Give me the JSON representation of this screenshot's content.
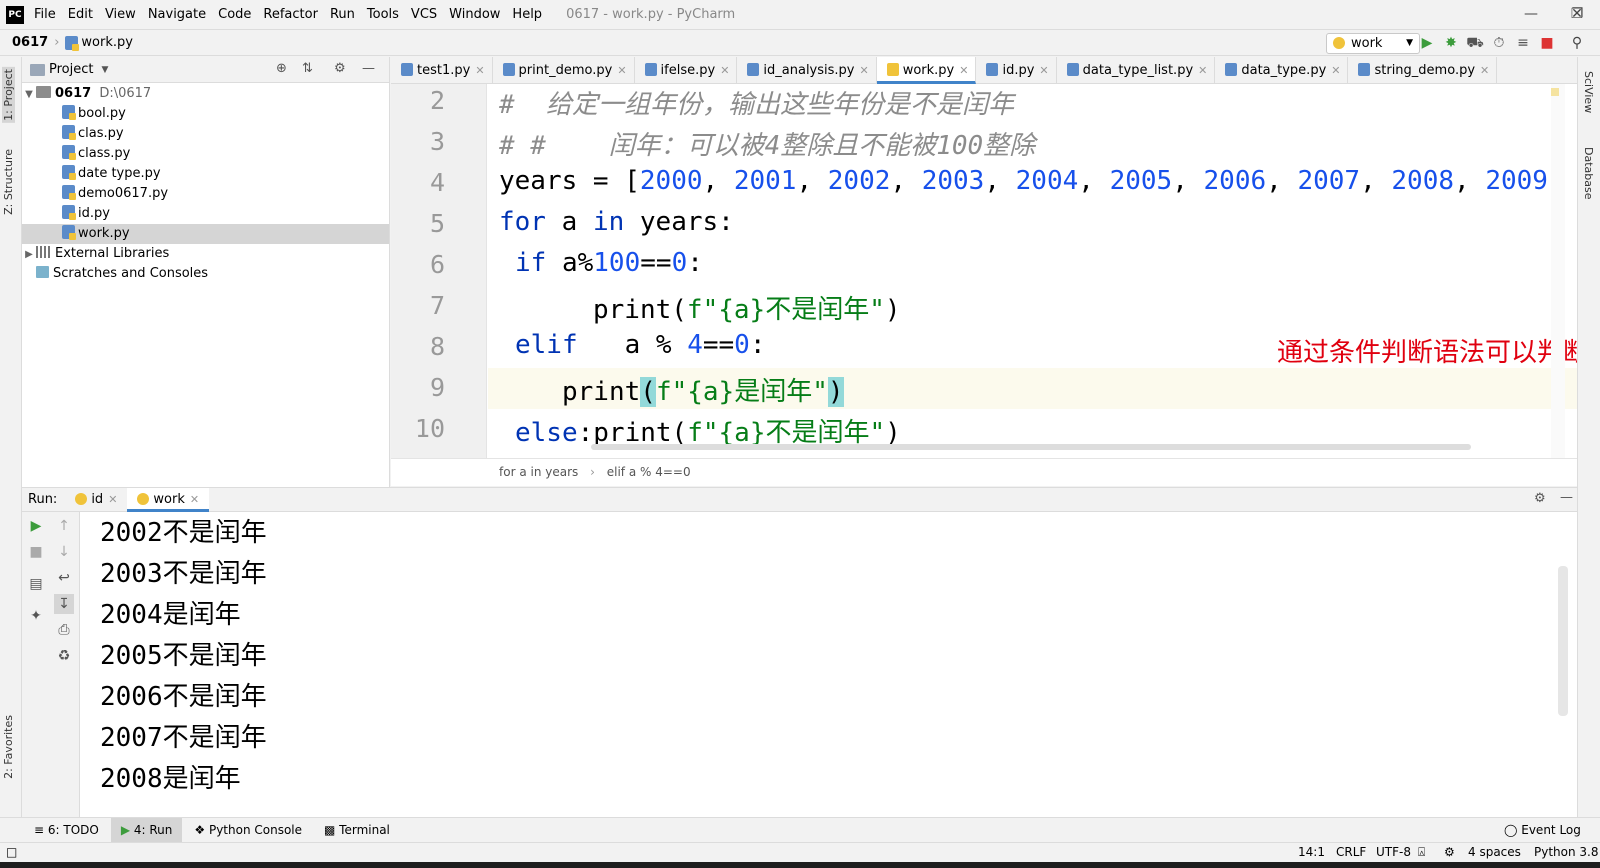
{
  "app": {
    "logo": "PC",
    "window_title": "0617 - work.py - PyCharm",
    "menu": [
      "File",
      "Edit",
      "View",
      "Navigate",
      "Code",
      "Refactor",
      "Run",
      "Tools",
      "VCS",
      "Window",
      "Help"
    ]
  },
  "navbar": {
    "project": "0617",
    "file": "work.py",
    "run_config": "work"
  },
  "left_stripe": {
    "project_tab": "1: Project",
    "structure_tab": "Z: Structure",
    "favorites_tab": "2: Favorites"
  },
  "right_stripe": {
    "sciview_tab": "SciView",
    "database_tab": "Database"
  },
  "project_panel": {
    "title": "Project",
    "root_name": "0617",
    "root_path": "D:\\0617",
    "files": [
      "bool.py",
      "clas.py",
      "class.py",
      "date type.py",
      "demo0617.py",
      "id.py",
      "work.py"
    ],
    "selected_file": "work.py",
    "external_libraries": "External Libraries",
    "scratches": "Scratches and Consoles"
  },
  "editor_tabs": [
    "test1.py",
    "print_demo.py",
    "ifelse.py",
    "id_analysis.py",
    "work.py",
    "id.py",
    "data_type_list.py",
    "data_type.py",
    "string_demo.py"
  ],
  "active_tab": "work.py",
  "editor": {
    "line_numbers": [
      "2",
      "3",
      "4",
      "5",
      "6",
      "7",
      "8",
      "9",
      "10"
    ],
    "comment1": "#  给定一组年份，输出这些年份是不是闰年",
    "comment2": "# #    闰年：可以被4整除且不能被100整除",
    "years_prefix": "years = [",
    "years_values": [
      "2000",
      "2001",
      "2002",
      "2003",
      "2004",
      "2005",
      "2006",
      "2007",
      "2008",
      "2009"
    ],
    "line5_for": "for",
    "line5_mid": " a ",
    "line5_in": "in",
    "line5_end": " years:",
    "line6_if": "if",
    "line6_a": " a%",
    "line6_100": "100",
    "line6_eq": "==",
    "line6_0": "0",
    "line6_colon": ":",
    "line7_print": "print(",
    "line7_str": "f\"{a}不是闰年\"",
    "line7_close": ")",
    "line8_elif": "elif",
    "line8_a": "   a % ",
    "line8_4": "4",
    "line8_eq": "==",
    "line8_0": "0",
    "line8_colon": ":",
    "line9_print": "print",
    "line9_open": "(",
    "line9_str": "f\"{a}是闰年\"",
    "line9_close": ")",
    "line10_else": "else",
    "line10_print": ":print(",
    "line10_str": "f\"{a}不是闰年\"",
    "line10_close": ")",
    "annotation": "通过条件判断语法可以判断符合条件与不符合条件的类别",
    "breadcrumb": [
      "for a in years",
      "elif a % 4==0"
    ]
  },
  "run_panel": {
    "label": "Run:",
    "tabs": [
      "id",
      "work"
    ],
    "active_tab": "work",
    "output": [
      "2002不是闰年",
      "2003不是闰年",
      "2004是闰年",
      "2005不是闰年",
      "2006不是闰年",
      "2007不是闰年",
      "2008是闰年"
    ]
  },
  "bottom_tools": {
    "todo": "6: TODO",
    "run": "4: Run",
    "python_console": "Python Console",
    "terminal": "Terminal",
    "event_log": "Event Log"
  },
  "status_bar": {
    "position": "14:1",
    "line_sep": "CRLF",
    "encoding": "UTF-8",
    "indent": "4 spaces",
    "interpreter": "Python 3.8"
  },
  "colors": {
    "keyword": "#0033b3",
    "number": "#1750eb",
    "string": "#067d17",
    "comment": "#8c8c8c",
    "annotation": "#e0000f",
    "active_tab_accent": "#4083c9"
  }
}
